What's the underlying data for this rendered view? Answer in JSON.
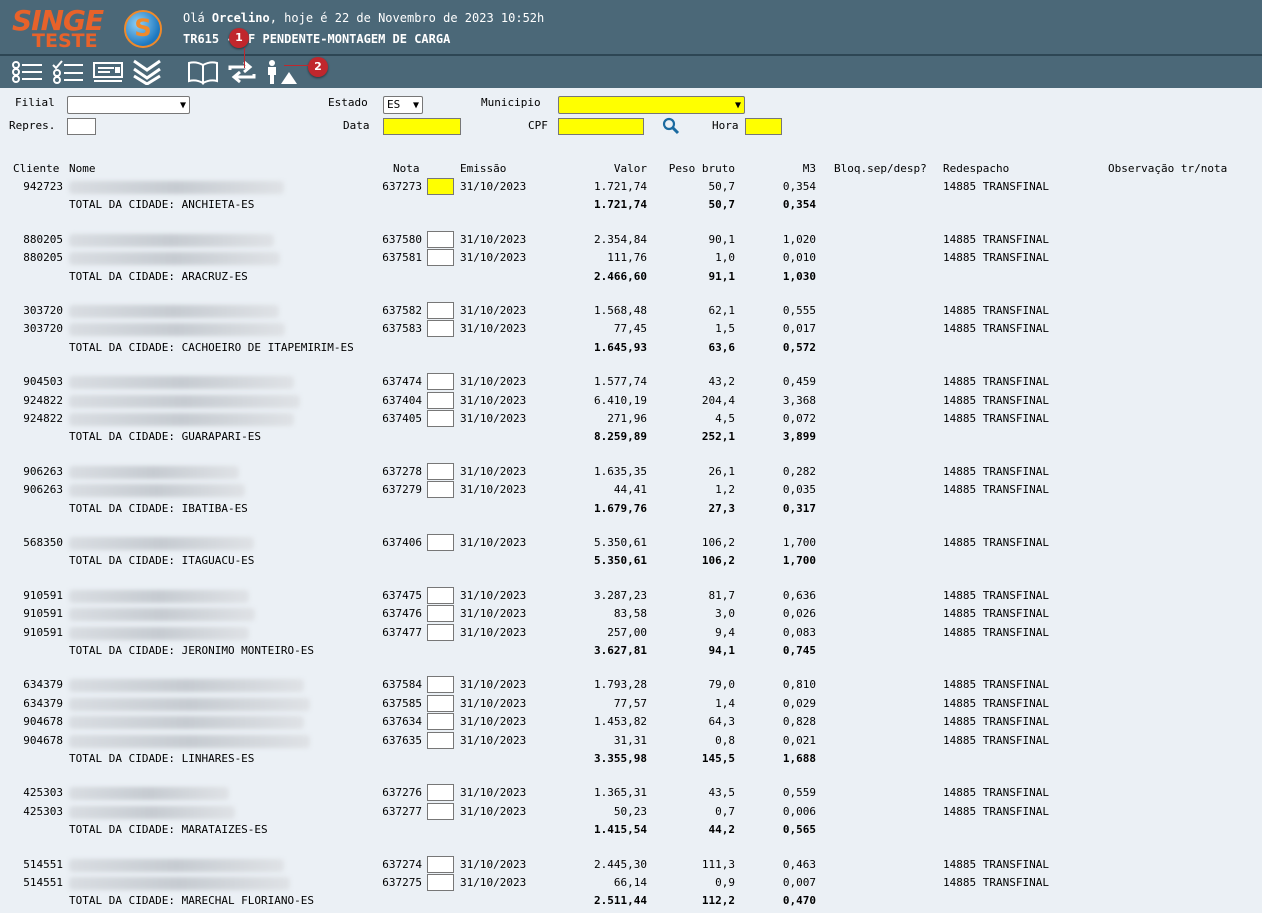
{
  "header": {
    "logo_line1": "SINGE",
    "logo_line2": "TESTE",
    "greeting_prefix": "Olá ",
    "user": "Orcelino",
    "greeting_suffix": ", hoje é 22 de Novembro de 2023 10:52h",
    "screen_title": "TR615 - NF PENDENTE-MONTAGEM DE CARGA"
  },
  "toolbar": {
    "buttons": [
      "list-icon",
      "checklist-icon",
      "card-icon",
      "double-chevron-icon",
      "book-icon",
      "swap-icon",
      "worker-icon"
    ],
    "markers": [
      "1",
      "2"
    ]
  },
  "filters": {
    "filial_label": "Filial",
    "filial_value": "",
    "estado_label": "Estado",
    "estado_value": "ES",
    "municipio_label": "Municipio",
    "municipio_value": "",
    "repres_label": "Repres.",
    "data_label": "Data",
    "cpf_label": "CPF",
    "hora_label": "Hora"
  },
  "columns": {
    "cliente": "Cliente",
    "nome": "Nome",
    "nota": "Nota",
    "emissao": "Emissão",
    "valor": "Valor",
    "peso": "Peso bruto",
    "m3": "M3",
    "bloq": "Bloq.sep/desp?",
    "redespacho": "Redespacho",
    "observacao": "Observação tr/nota"
  },
  "groups": [
    {
      "rows": [
        {
          "cliente": "942723",
          "nota": "637273",
          "emissao": "31/10/2023",
          "valor": "1.721,74",
          "peso": "50,7",
          "m3": "0,354",
          "redespacho": "14885 TRANSFINAL",
          "checked": true
        }
      ],
      "total_label": "TOTAL DA CIDADE: ANCHIETA-ES",
      "total_valor": "1.721,74",
      "total_peso": "50,7",
      "total_m3": "0,354"
    },
    {
      "rows": [
        {
          "cliente": "880205",
          "nota": "637580",
          "emissao": "31/10/2023",
          "valor": "2.354,84",
          "peso": "90,1",
          "m3": "1,020",
          "redespacho": "14885 TRANSFINAL"
        },
        {
          "cliente": "880205",
          "nota": "637581",
          "emissao": "31/10/2023",
          "valor": "111,76",
          "peso": "1,0",
          "m3": "0,010",
          "redespacho": "14885 TRANSFINAL"
        }
      ],
      "total_label": "TOTAL DA CIDADE: ARACRUZ-ES",
      "total_valor": "2.466,60",
      "total_peso": "91,1",
      "total_m3": "1,030"
    },
    {
      "rows": [
        {
          "cliente": "303720",
          "nota": "637582",
          "emissao": "31/10/2023",
          "valor": "1.568,48",
          "peso": "62,1",
          "m3": "0,555",
          "redespacho": "14885 TRANSFINAL"
        },
        {
          "cliente": "303720",
          "nota": "637583",
          "emissao": "31/10/2023",
          "valor": "77,45",
          "peso": "1,5",
          "m3": "0,017",
          "redespacho": "14885 TRANSFINAL"
        }
      ],
      "total_label": "TOTAL DA CIDADE: CACHOEIRO DE ITAPEMIRIM-ES",
      "total_valor": "1.645,93",
      "total_peso": "63,6",
      "total_m3": "0,572"
    },
    {
      "rows": [
        {
          "cliente": "904503",
          "nota": "637474",
          "emissao": "31/10/2023",
          "valor": "1.577,74",
          "peso": "43,2",
          "m3": "0,459",
          "redespacho": "14885 TRANSFINAL"
        },
        {
          "cliente": "924822",
          "nota": "637404",
          "emissao": "31/10/2023",
          "valor": "6.410,19",
          "peso": "204,4",
          "m3": "3,368",
          "redespacho": "14885 TRANSFINAL"
        },
        {
          "cliente": "924822",
          "nota": "637405",
          "emissao": "31/10/2023",
          "valor": "271,96",
          "peso": "4,5",
          "m3": "0,072",
          "redespacho": "14885 TRANSFINAL"
        }
      ],
      "total_label": "TOTAL DA CIDADE: GUARAPARI-ES",
      "total_valor": "8.259,89",
      "total_peso": "252,1",
      "total_m3": "3,899"
    },
    {
      "rows": [
        {
          "cliente": "906263",
          "nota": "637278",
          "emissao": "31/10/2023",
          "valor": "1.635,35",
          "peso": "26,1",
          "m3": "0,282",
          "redespacho": "14885 TRANSFINAL"
        },
        {
          "cliente": "906263",
          "nota": "637279",
          "emissao": "31/10/2023",
          "valor": "44,41",
          "peso": "1,2",
          "m3": "0,035",
          "redespacho": "14885 TRANSFINAL"
        }
      ],
      "total_label": "TOTAL DA CIDADE: IBATIBA-ES",
      "total_valor": "1.679,76",
      "total_peso": "27,3",
      "total_m3": "0,317"
    },
    {
      "rows": [
        {
          "cliente": "568350",
          "nota": "637406",
          "emissao": "31/10/2023",
          "valor": "5.350,61",
          "peso": "106,2",
          "m3": "1,700",
          "redespacho": "14885 TRANSFINAL"
        }
      ],
      "total_label": "TOTAL DA CIDADE: ITAGUACU-ES",
      "total_valor": "5.350,61",
      "total_peso": "106,2",
      "total_m3": "1,700"
    },
    {
      "rows": [
        {
          "cliente": "910591",
          "nota": "637475",
          "emissao": "31/10/2023",
          "valor": "3.287,23",
          "peso": "81,7",
          "m3": "0,636",
          "redespacho": "14885 TRANSFINAL"
        },
        {
          "cliente": "910591",
          "nota": "637476",
          "emissao": "31/10/2023",
          "valor": "83,58",
          "peso": "3,0",
          "m3": "0,026",
          "redespacho": "14885 TRANSFINAL"
        },
        {
          "cliente": "910591",
          "nota": "637477",
          "emissao": "31/10/2023",
          "valor": "257,00",
          "peso": "9,4",
          "m3": "0,083",
          "redespacho": "14885 TRANSFINAL"
        }
      ],
      "total_label": "TOTAL DA CIDADE: JERONIMO MONTEIRO-ES",
      "total_valor": "3.627,81",
      "total_peso": "94,1",
      "total_m3": "0,745"
    },
    {
      "rows": [
        {
          "cliente": "634379",
          "nota": "637584",
          "emissao": "31/10/2023",
          "valor": "1.793,28",
          "peso": "79,0",
          "m3": "0,810",
          "redespacho": "14885 TRANSFINAL"
        },
        {
          "cliente": "634379",
          "nota": "637585",
          "emissao": "31/10/2023",
          "valor": "77,57",
          "peso": "1,4",
          "m3": "0,029",
          "redespacho": "14885 TRANSFINAL"
        },
        {
          "cliente": "904678",
          "nota": "637634",
          "emissao": "31/10/2023",
          "valor": "1.453,82",
          "peso": "64,3",
          "m3": "0,828",
          "redespacho": "14885 TRANSFINAL"
        },
        {
          "cliente": "904678",
          "nota": "637635",
          "emissao": "31/10/2023",
          "valor": "31,31",
          "peso": "0,8",
          "m3": "0,021",
          "redespacho": "14885 TRANSFINAL"
        }
      ],
      "total_label": "TOTAL DA CIDADE: LINHARES-ES",
      "total_valor": "3.355,98",
      "total_peso": "145,5",
      "total_m3": "1,688"
    },
    {
      "rows": [
        {
          "cliente": "425303",
          "nota": "637276",
          "emissao": "31/10/2023",
          "valor": "1.365,31",
          "peso": "43,5",
          "m3": "0,559",
          "redespacho": "14885 TRANSFINAL"
        },
        {
          "cliente": "425303",
          "nota": "637277",
          "emissao": "31/10/2023",
          "valor": "50,23",
          "peso": "0,7",
          "m3": "0,006",
          "redespacho": "14885 TRANSFINAL"
        }
      ],
      "total_label": "TOTAL DA CIDADE: MARATAIZES-ES",
      "total_valor": "1.415,54",
      "total_peso": "44,2",
      "total_m3": "0,565"
    },
    {
      "rows": [
        {
          "cliente": "514551",
          "nota": "637274",
          "emissao": "31/10/2023",
          "valor": "2.445,30",
          "peso": "111,3",
          "m3": "0,463",
          "redespacho": "14885 TRANSFINAL"
        },
        {
          "cliente": "514551",
          "nota": "637275",
          "emissao": "31/10/2023",
          "valor": "66,14",
          "peso": "0,9",
          "m3": "0,007",
          "redespacho": "14885 TRANSFINAL"
        }
      ],
      "total_label": "TOTAL DA CIDADE: MARECHAL FLORIANO-ES",
      "total_valor": "2.511,44",
      "total_peso": "112,2",
      "total_m3": "0,470"
    }
  ]
}
